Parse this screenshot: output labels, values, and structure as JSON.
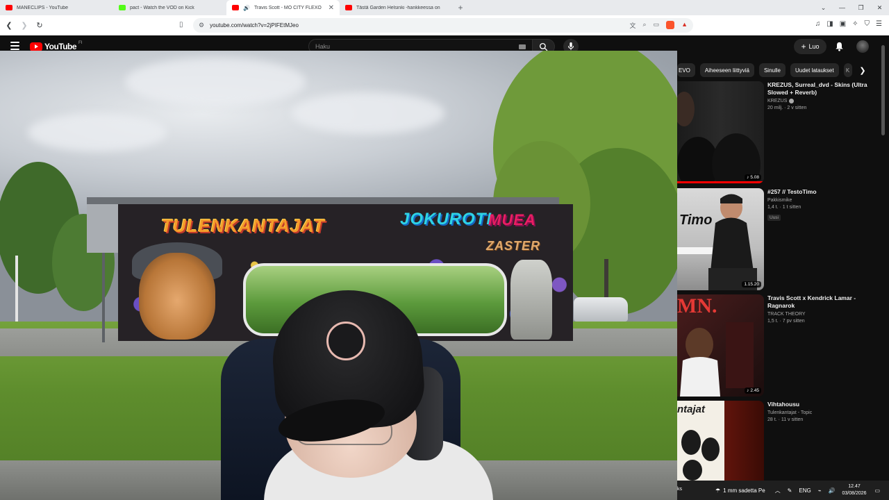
{
  "browser": {
    "tabs": [
      {
        "title": "MANECLIPS - YouTube",
        "icon": "youtube-icon",
        "active": false
      },
      {
        "title": "pact - Watch the VOD on Kick",
        "icon": "kick-icon",
        "active": false
      },
      {
        "title": "Travis Scott - MO CITY FLEXO",
        "icon": "youtube-icon",
        "active": true
      },
      {
        "title": "Tästä Garden Helsinki -hankkeessa on",
        "icon": "youtube-icon",
        "active": false
      }
    ],
    "url": "youtube.com/watch?v=2jPIFEtMJeo"
  },
  "youtube": {
    "logo_text": "YouTube",
    "logo_suffix": "FI",
    "search_placeholder": "Haku",
    "create_label": "Luo"
  },
  "mural": {
    "text_left": "TULENKANTAJAT",
    "text_right_1": "JOKUROTI",
    "text_right_2": "MUEA",
    "text_right_3": "ZASTER"
  },
  "chips": [
    "EVO",
    "Aiheeseen liittyviä",
    "Sinulle",
    "Uudet lataukset"
  ],
  "recommendations": [
    {
      "title": "KREZUS, Surreal_dvd - Skins (Ultra Slowed + Reverb)",
      "channel": "KREZUS",
      "verified": true,
      "stats": "20 milj. · 2 v sitten",
      "duration": "5.08",
      "tag": ""
    },
    {
      "title": "#257 // TestoTimo",
      "channel": "Pakkismike",
      "verified": false,
      "stats": "1,4 t. · 1 t sitten",
      "duration": "1.15.20",
      "tag": "Uusi"
    },
    {
      "title": "Travis Scott x Kendrick Lamar - Ragnarok",
      "channel": "TRACK THEORY",
      "verified": false,
      "stats": "1,5 t. · 7 pv sitten",
      "duration": "2.45",
      "tag": ""
    },
    {
      "title": "Vihtahousu",
      "channel": "Tulenkantajat - Topic",
      "verified": false,
      "stats": "28 t. · 11 v sitten",
      "duration": "",
      "tag": ""
    }
  ],
  "thumb_text": {
    "timo": "Timo",
    "mn": "MN.",
    "ntajat": "ntajat"
  },
  "taskbar": {
    "cut_text": "ks",
    "weather": "1 mm sadetta Pe",
    "lang": "ENG",
    "time": "12.47",
    "date": "03/08/2026"
  },
  "colors": {
    "youtube_red": "#ff0000",
    "yt_bg": "#0f0f0f",
    "chip_bg": "#272727"
  }
}
